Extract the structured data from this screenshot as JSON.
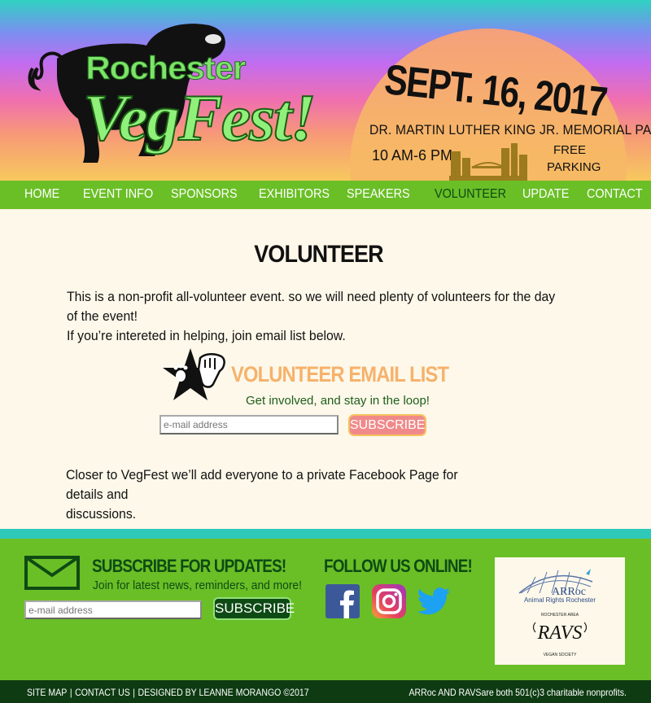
{
  "header": {
    "logo_line1": "Rochester",
    "logo_line2": "VegFest!",
    "date": "SEPT. 16, 2017",
    "park": "DR. MARTIN LUTHER KING JR. MEMORIAL PARK",
    "hours": "10 AM-6 PM",
    "parking_line1": "FREE",
    "parking_line2": "PARKING"
  },
  "nav": {
    "items": [
      {
        "label": "HOME"
      },
      {
        "label": "EVENT INFO"
      },
      {
        "label": "SPONSORS"
      },
      {
        "label": "EXHIBITORS"
      },
      {
        "label": "SPEAKERS"
      },
      {
        "label": "VOLUNTEER"
      },
      {
        "label": "UPDATE"
      },
      {
        "label": "CONTACT"
      }
    ],
    "active": "VOLUNTEER"
  },
  "main": {
    "title": "VOLUNTEER",
    "intro_line1": "This is a non-profit all-volunteer event. so we will need plenty of volunteers for the day of the event!",
    "intro_line2": "If you’re intereted in helping, join email list below.",
    "volunteer_title": "VOLUNTEER EMAIL LIST",
    "volunteer_subtitle": "Get involved, and stay in the loop!",
    "email_placeholder": "e-mail address",
    "subscribe_label": "SUBSCRIBE",
    "closer_line1": "Closer to VegFest we’ll add everyone to a private Facebook Page for details and",
    "closer_line2": "discussions."
  },
  "footer": {
    "subscribe_title": "SUBSCRIBE FOR UPDATES!",
    "subscribe_text": "Join for latest news, reminders, and more!",
    "email_placeholder": "e-mail address",
    "subscribe_label": "SUBSCRIBE",
    "follow_title": "FOLLOW US ONLINE!",
    "social": [
      "facebook-icon",
      "instagram-icon",
      "twitter-icon"
    ],
    "org1_name": "ARRoc",
    "org1_sub": "Animal Rights Rochester",
    "org2_top": "ROCHESTER AREA",
    "org2_name": "RAVS",
    "org2_bottom": "VEGAN SOCIETY",
    "links": [
      "SITE MAP",
      "CONTACT US",
      "DESIGNED BY LEANNE MORANGO ©2017"
    ],
    "nonprofit_text": "ARRoc AND RAVSare both 501(c)3 charitable nonprofits."
  },
  "colors": {
    "nav_green": "#6abf26",
    "dark_green": "#0e3b12",
    "teal": "#2ec9b9",
    "cream": "#fdf8ea",
    "orange_title": "#f6b26b"
  }
}
